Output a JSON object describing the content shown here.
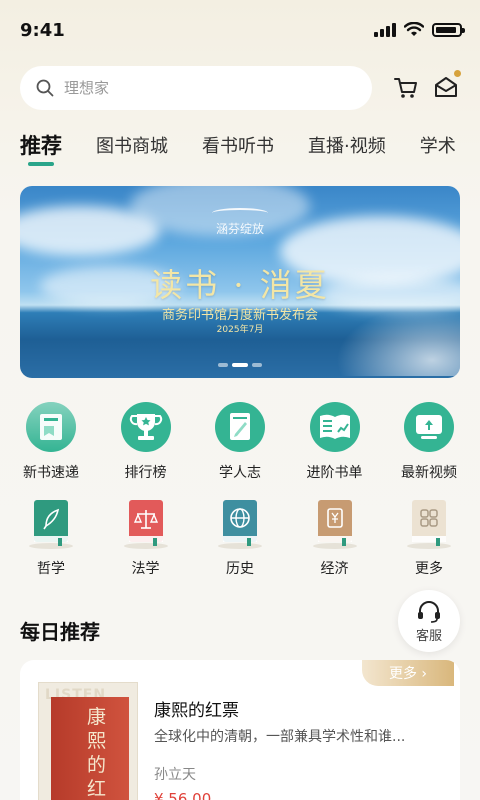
{
  "status": {
    "time": "9:41"
  },
  "search": {
    "placeholder": "理想家"
  },
  "tabs": [
    {
      "label": "推荐",
      "active": true
    },
    {
      "label": "图书商城"
    },
    {
      "label": "看书听书"
    },
    {
      "label": "直播·视频"
    },
    {
      "label": "学术"
    }
  ],
  "banner": {
    "logo_text": "涵芬绽放",
    "title": "读书 · 消夏",
    "subtitle": "商务印书馆月度新书发布会",
    "date": "2025年7月"
  },
  "quick_links": [
    {
      "label": "新书速递",
      "icon": "new-book-icon"
    },
    {
      "label": "排行榜",
      "icon": "trophy-icon"
    },
    {
      "label": "学人志",
      "icon": "scholar-book-icon"
    },
    {
      "label": "进阶书单",
      "icon": "reading-list-icon"
    },
    {
      "label": "最新视频",
      "icon": "video-icon"
    }
  ],
  "categories": [
    {
      "label": "哲学",
      "icon": "philosophy-book-icon",
      "color": "#2f9a7f"
    },
    {
      "label": "法学",
      "icon": "law-book-icon",
      "color": "#e25a5a"
    },
    {
      "label": "历史",
      "icon": "history-book-icon",
      "color": "#3f8fa0"
    },
    {
      "label": "经济",
      "icon": "economy-book-icon",
      "color": "#c79b72"
    },
    {
      "label": "更多",
      "icon": "more-book-icon",
      "color": "#e8dccb"
    }
  ],
  "daily": {
    "title": "每日推荐",
    "more": "更多 ›",
    "book": {
      "cover_ghost": "LISTEN",
      "cover_title": "康熙的红票",
      "title": "康熙的红票",
      "desc": "全球化中的清朝，一部兼具学术性和谁...",
      "author": "孙立天",
      "price": "¥ 56.00"
    }
  },
  "service": {
    "label": "客服"
  },
  "colors": {
    "accent": "#2aa58a",
    "price": "#e0423a",
    "tag_gold": "#d9b77c"
  }
}
